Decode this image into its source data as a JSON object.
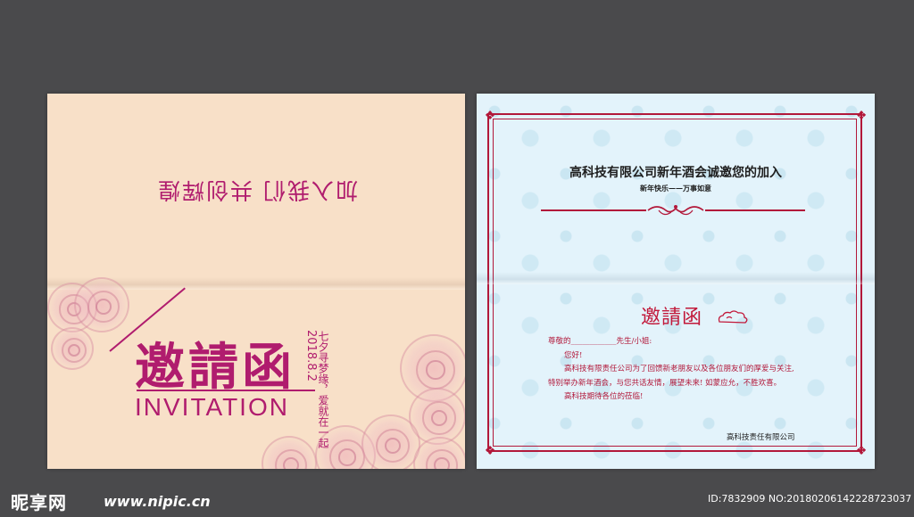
{
  "cover": {
    "upside_text": "加入我们 共创辉煌",
    "title": "邀請函",
    "subtitle": "INVITATION",
    "vertical_line": "七夕寻梦缘，爱就在一起",
    "date": "2018.8.2"
  },
  "letter": {
    "title": "高科技有限公司新年酒会诚邀您的加入",
    "subtitle": "新年快乐——万事如意",
    "heading": "邀請函",
    "greeting": "尊敬的____________先生/小姐:",
    "hello": "您好!",
    "body1": "高科技有限责任公司为了回馈新老朋友以及各位朋友们的厚爱与关注,",
    "body2": "特别举办新年酒会，与您共话友情，展望未来! 如蒙应允，不胜欢喜。",
    "body3": "高科技期待各位的莅临!",
    "signature": "高科技责任有限公司"
  },
  "footer": {
    "logo": "昵享网",
    "site": "www.nipic.cn",
    "id_text": "ID:7832909 NO:20180206142228723037"
  },
  "colors": {
    "background": "#4a4a4c",
    "cover_bg": "#f8e0c8",
    "accent_magenta": "#b01c6e",
    "letter_bg": "#e3f3fb",
    "frame_red": "#b2183a"
  }
}
